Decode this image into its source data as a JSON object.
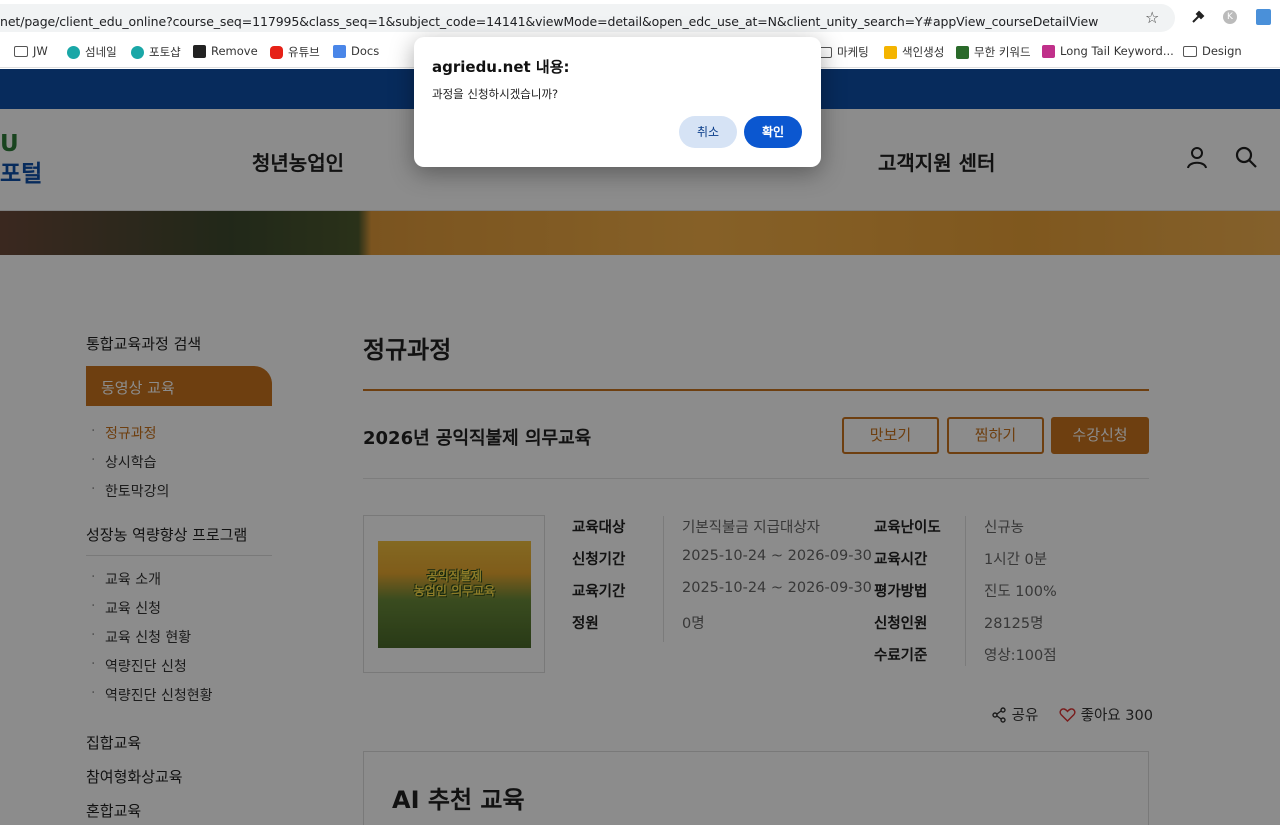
{
  "browser": {
    "url": "net/page/client_edu_online?course_seq=117995&class_seq=1&subject_code=14141&viewMode=detail&open_edc_use_at=N&client_unity_search=Y#appView_courseDetailView",
    "bookmarks": [
      "JW",
      "섬네일",
      "포토샵",
      "Remove",
      "유튜브",
      "Docs",
      "마케팅",
      "색인생성",
      "무한 키워드",
      "Long Tail Keyword...",
      "Design"
    ]
  },
  "header": {
    "logo_line1": "U",
    "logo_line2": "포털",
    "nav": [
      "청년농업인",
      "고객지원 센터"
    ]
  },
  "sidebar": {
    "search": "통합교육과정 검색",
    "active": "동영상 교육",
    "sub1": [
      "정규과정",
      "상시학습",
      "한토막강의"
    ],
    "group2": "성장농 역량향상 프로그램",
    "sub2": [
      "교육 소개",
      "교육 신청",
      "교육 신청 현황",
      "역량진단 신청",
      "역량진단 신청현황"
    ],
    "others": [
      "집합교육",
      "참여형화상교육",
      "혼합교육"
    ]
  },
  "main": {
    "page_title": "정규과정",
    "course_title": "2026년 공익직불제 의무교육",
    "buttons": [
      "맛보기",
      "찜하기",
      "수강신청"
    ],
    "thumb_text": [
      "공익직불제",
      "농업인 의무교육"
    ],
    "info_left": [
      {
        "label": "교육대상",
        "value": "기본직불금 지급대상자"
      },
      {
        "label": "신청기간",
        "value": "2025-10-24 ~ 2026-09-30"
      },
      {
        "label": "교육기간",
        "value": "2025-10-24 ~ 2026-09-30"
      },
      {
        "label": "정원",
        "value": "0명"
      }
    ],
    "info_right": [
      {
        "label": "교육난이도",
        "value": "신규농"
      },
      {
        "label": "교육시간",
        "value": "1시간 0분"
      },
      {
        "label": "평가방법",
        "value": "진도 100%"
      },
      {
        "label": "신청인원",
        "value": "28125명"
      },
      {
        "label": "수료기준",
        "value": "영상:100점"
      }
    ],
    "share": "공유",
    "like": "좋아요 300",
    "ai_title": "AI 추천 교육"
  },
  "dialog": {
    "title": "agriedu.net 내용:",
    "message": "과정을 신청하시겠습니까?",
    "cancel": "취소",
    "ok": "확인"
  },
  "colors": {
    "accent": "#c8731e",
    "banner": "#0e4fa8",
    "dialog_ok": "#0b57d0"
  }
}
